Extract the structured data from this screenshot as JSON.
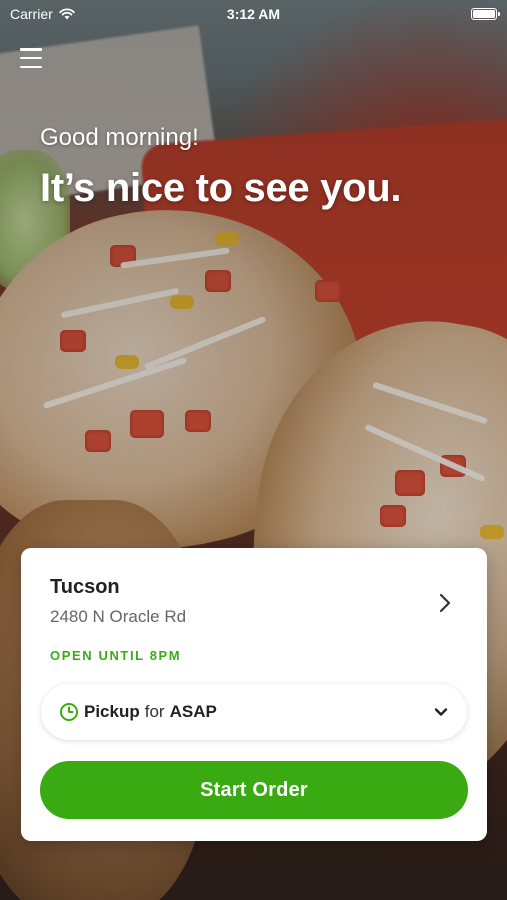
{
  "status_bar": {
    "carrier": "Carrier",
    "time": "3:12 AM",
    "battery_level": 1.0
  },
  "icons": {
    "menu": "menu-icon",
    "wifi": "wifi-icon",
    "battery": "battery-icon",
    "chevron_right": "chevron-right-icon",
    "clock": "clock-icon",
    "chevron_down": "chevron-down-icon"
  },
  "hero": {
    "greeting": "Good morning!",
    "headline": "It’s nice to see you."
  },
  "store": {
    "city": "Tucson",
    "address": "2480 N Oracle Rd",
    "hours": "OPEN UNTIL 8PM"
  },
  "order_mode": {
    "mode": "Pickup",
    "connector": "for",
    "time": "ASAP"
  },
  "actions": {
    "start_order_label": "Start Order"
  },
  "colors": {
    "accent_green": "#3aaa13",
    "status_green": "#3aad16",
    "card_background": "#ffffff"
  }
}
